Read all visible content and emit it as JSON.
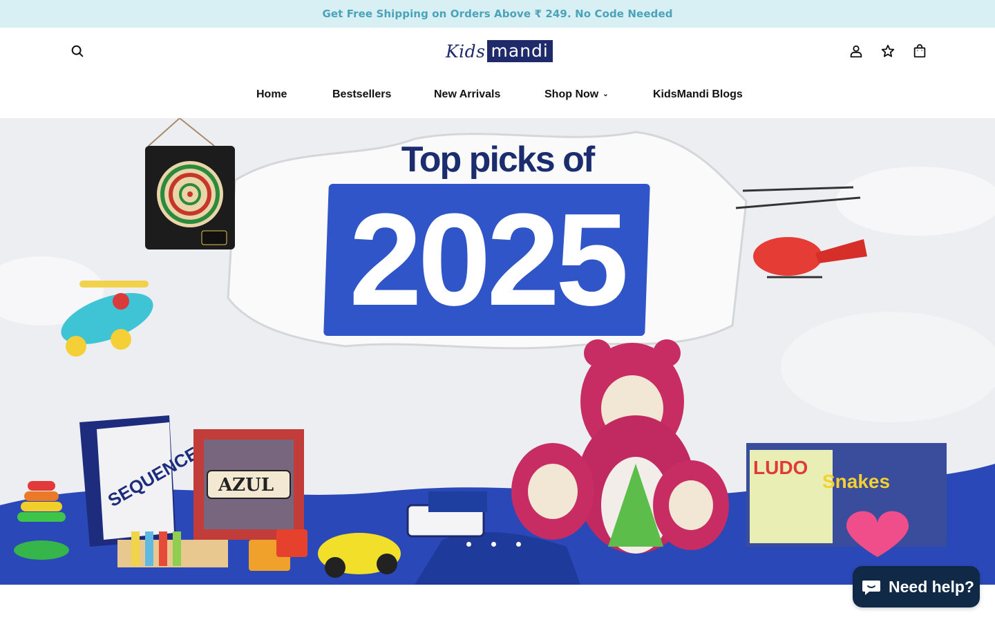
{
  "announcement": {
    "text": "Get Free Shipping on Orders Above ₹ 249. No Code Needed"
  },
  "header": {
    "logo": {
      "part1": "Kids",
      "part2": "mandi"
    },
    "icons": {
      "search": "search-icon",
      "account": "user-icon",
      "wishlist": "star-icon",
      "cart": "bag-icon"
    }
  },
  "nav": {
    "items": [
      {
        "label": "Home"
      },
      {
        "label": "Bestsellers"
      },
      {
        "label": "New Arrivals"
      },
      {
        "label": "Shop Now",
        "has_dropdown": true
      },
      {
        "label": "KidsMandi Blogs"
      }
    ]
  },
  "hero": {
    "headline": "Top picks of",
    "year": "2025",
    "slides_count": 3,
    "active_slide": 2
  },
  "chat": {
    "label": "Need help?",
    "icon": "chat-bubble-icon"
  },
  "colors": {
    "announcement_bg": "#d8f0f4",
    "announcement_text": "#4aa3b8",
    "brand_navy": "#1f2a6b",
    "hero_blue": "#2f55c8",
    "chat_bg": "#0f2947"
  }
}
